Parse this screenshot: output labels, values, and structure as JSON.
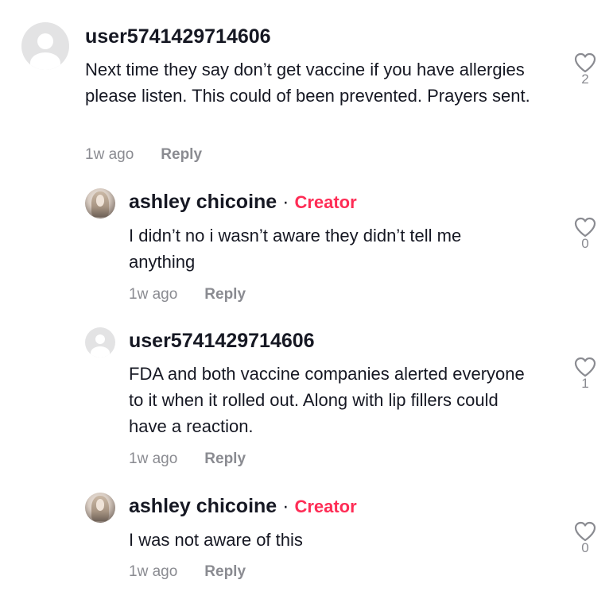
{
  "comments": [
    {
      "username": "user5741429714606",
      "is_creator": false,
      "text": "Next time they say don’t get vaccine if you have allergies please listen. This could of been prevented. Prayers sent.",
      "time": "1w ago",
      "reply_label": "Reply",
      "likes": "2"
    },
    {
      "username": "ashley chicoine",
      "is_creator": true,
      "separator": "·",
      "creator_label": "Creator",
      "text": "I didn’t no i wasn’t aware they didn’t tell me anything",
      "time": "1w ago",
      "reply_label": "Reply",
      "likes": "0"
    },
    {
      "username": "user5741429714606",
      "is_creator": false,
      "text": "FDA and both vaccine companies alerted everyone to it when it rolled out. Along with lip fillers could have a reaction.",
      "time": "1w ago",
      "reply_label": "Reply",
      "likes": "1"
    },
    {
      "username": "ashley chicoine",
      "is_creator": true,
      "separator": "·",
      "creator_label": "Creator",
      "text": "I was not aware of this",
      "time": "1w ago",
      "reply_label": "Reply",
      "likes": "0"
    }
  ],
  "icons": {
    "like": "heart-outline-icon",
    "default_avatar": "default-user-avatar",
    "creator_avatar": "profile-photo-avatar"
  },
  "colors": {
    "creator_accent": "#fe2c55",
    "muted": "#8a8b91",
    "text": "#161823"
  }
}
